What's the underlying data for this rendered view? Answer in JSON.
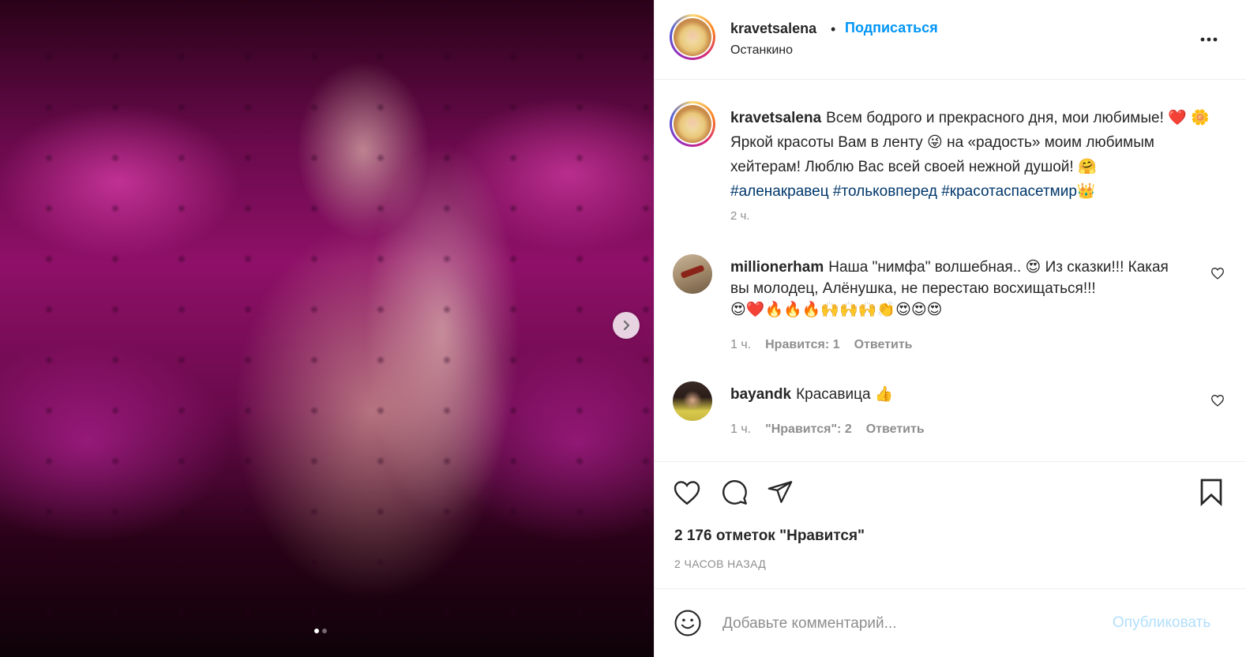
{
  "media": {
    "image_alt": "photo",
    "next_icon": "chevron-right-icon",
    "carousel_count": 2,
    "carousel_active": 1
  },
  "header": {
    "username": "kravetsalena",
    "separator": "•",
    "follow_label": "Подписаться",
    "location": "Останкино",
    "more_icon": "more-horizontal-icon"
  },
  "caption": {
    "username": "kravetsalena",
    "line1": "Всем бодрого и прекрасного дня, мои любимые!",
    "emoji1": "❤️",
    "emoji2": "🌼",
    "line2": "Яркой красоты Вам в ленту",
    "emoji3": "😜",
    "line3": "на «радость» моим любимым хейтерам! Люблю Вас всей своей нежной душой!",
    "emoji4": "🤗",
    "hashtags": [
      "#аленакравец",
      "#тольковперед",
      "#красотаспасетмир"
    ],
    "emoji5": "👑",
    "time": "2 ч."
  },
  "comments": [
    {
      "username": "millionerham",
      "text_a": "Наша \"нимфа\" волшебная..",
      "emoji_a": "😍",
      "text_b": "Из сказки!!! Какая вы молодец, Алёнушка, не перестаю восхищаться!!!",
      "emoji_row": "😍❤️🔥🔥🔥🙌🙌🙌👏😍😍😍",
      "time": "1 ч.",
      "likes": "Нравится: 1",
      "reply": "Ответить"
    },
    {
      "username": "bayandk",
      "text_a": "Красавица",
      "emoji_a": "👍",
      "time": "1 ч.",
      "likes": "\"Нравится\": 2",
      "reply": "Ответить"
    }
  ],
  "actions": {
    "icons": [
      "heart-icon",
      "comment-icon",
      "share-icon",
      "bookmark-icon"
    ],
    "likes_count": "2 176 отметок \"Нравится\"",
    "post_time": "2 ЧАСОВ НАЗАД"
  },
  "add_comment": {
    "placeholder": "Добавьте комментарий...",
    "publish_label": "Опубликовать",
    "emoji_icon": "smiley-icon"
  },
  "colors": {
    "accent": "#0095f6",
    "hashtag": "#00376b",
    "muted": "#8e8e8e",
    "publish_disabled": "#b2dffc"
  }
}
